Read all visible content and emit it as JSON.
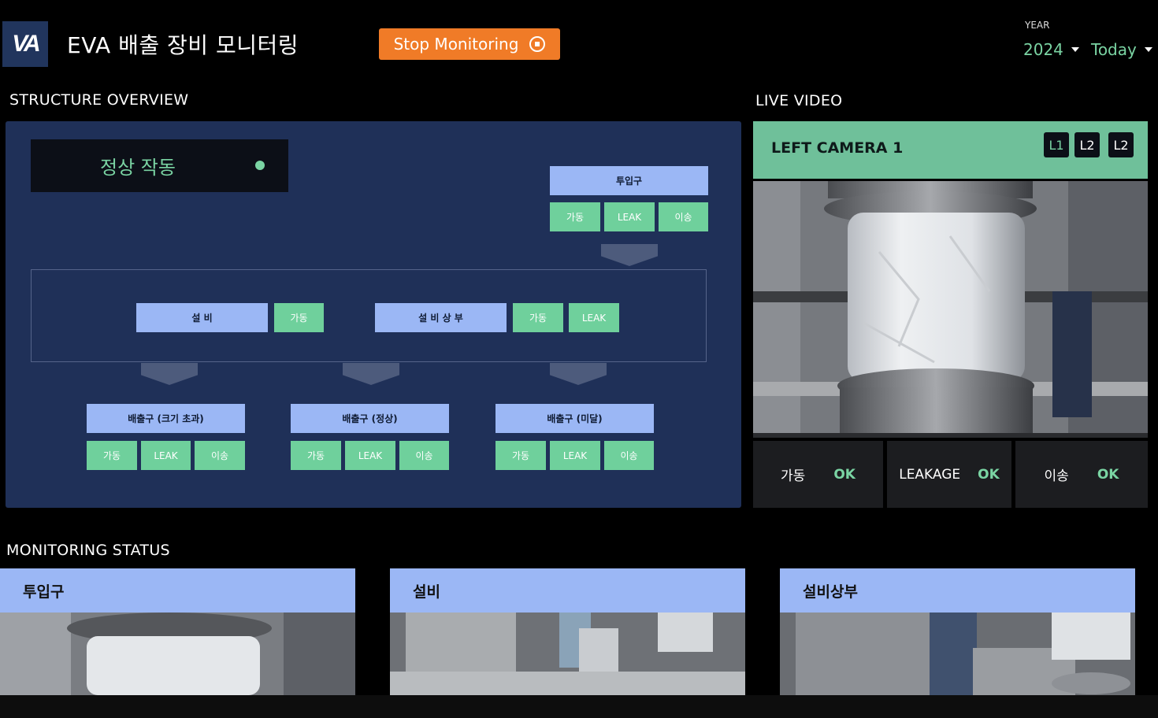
{
  "header": {
    "logo_text": "VA",
    "title": "EVA 배출 장비 모니터링",
    "stop_label": "Stop Monitoring",
    "year_label": "YEAR",
    "year_value": "2024",
    "period_value": "Today"
  },
  "structure": {
    "section_title": "STRUCTURE OVERVIEW",
    "status_text": "정상 작동",
    "inlet": {
      "label": "투입구",
      "tags": [
        "가동",
        "LEAK",
        "이송"
      ]
    },
    "equipment": {
      "label": "설 비",
      "tags": [
        "가동"
      ]
    },
    "equipment_top": {
      "label": "설 비 상 부",
      "tags": [
        "가동",
        "LEAK"
      ]
    },
    "outlets": [
      {
        "label": "배출구 (크기 초과)",
        "tags": [
          "가동",
          "LEAK",
          "이송"
        ]
      },
      {
        "label": "배출구 (정상)",
        "tags": [
          "가동",
          "LEAK",
          "이송"
        ]
      },
      {
        "label": "배출구 (미달)",
        "tags": [
          "가동",
          "LEAK",
          "이송"
        ]
      }
    ]
  },
  "live": {
    "section_title": "LIVE VIDEO",
    "camera_title": "LEFT CAMERA 1",
    "camera_buttons": [
      "L1",
      "L2",
      "L2"
    ],
    "metrics": [
      {
        "label": "가동",
        "value": "OK"
      },
      {
        "label": "LEAKAGE",
        "value": "OK"
      },
      {
        "label": "이송",
        "value": "OK"
      }
    ]
  },
  "monitoring": {
    "section_title": "MONITORING STATUS",
    "cards": [
      {
        "title": "투입구"
      },
      {
        "title": "설비"
      },
      {
        "title": "설비상부"
      }
    ]
  },
  "colors": {
    "accent_green": "#7ad4a3",
    "node_blue": "#9bb7f5",
    "panel_navy": "#1f3058",
    "stop_orange": "#f07b27"
  }
}
